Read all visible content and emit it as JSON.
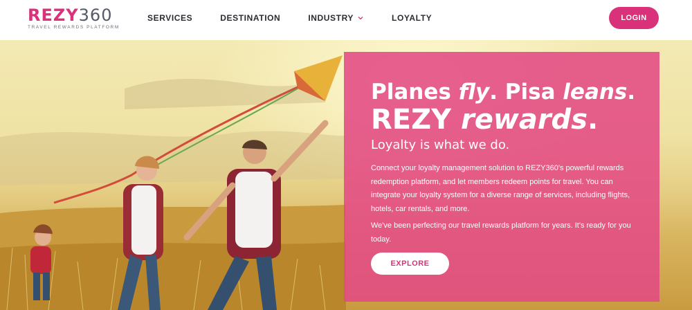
{
  "header": {
    "logo": {
      "brand": "REZY",
      "number": "360",
      "tagline": "TRAVEL REWARDS PLATFORM"
    },
    "nav": [
      {
        "label": "SERVICES"
      },
      {
        "label": "DESTINATION"
      },
      {
        "label": "INDUSTRY",
        "icon": "chevron-down-icon"
      },
      {
        "label": "LOYALTY"
      }
    ],
    "login_label": "LOGIN"
  },
  "hero": {
    "headline": {
      "line1_a": "Planes ",
      "line1_b": "fly",
      "line1_c": ". Pisa ",
      "line1_d": "leans",
      "line1_e": ".",
      "line2_a": "REZY ",
      "line2_b": "rewards",
      "line2_c": "."
    },
    "subhead": "Loyalty is what we do.",
    "paragraph1": "Connect your loyalty management solution to REZY360's powerful rewards redemption platform, and let members redeem points for travel. You can integrate your loyalty system for a diverse range of services, including flights, hotels, car rentals, and more.",
    "paragraph2": "We've been perfecting our travel rewards platform for years. It's ready for you today.",
    "explore_label": "EXPLORE"
  },
  "colors": {
    "accent": "#d9327a",
    "promo_bg": "#e24a84"
  }
}
